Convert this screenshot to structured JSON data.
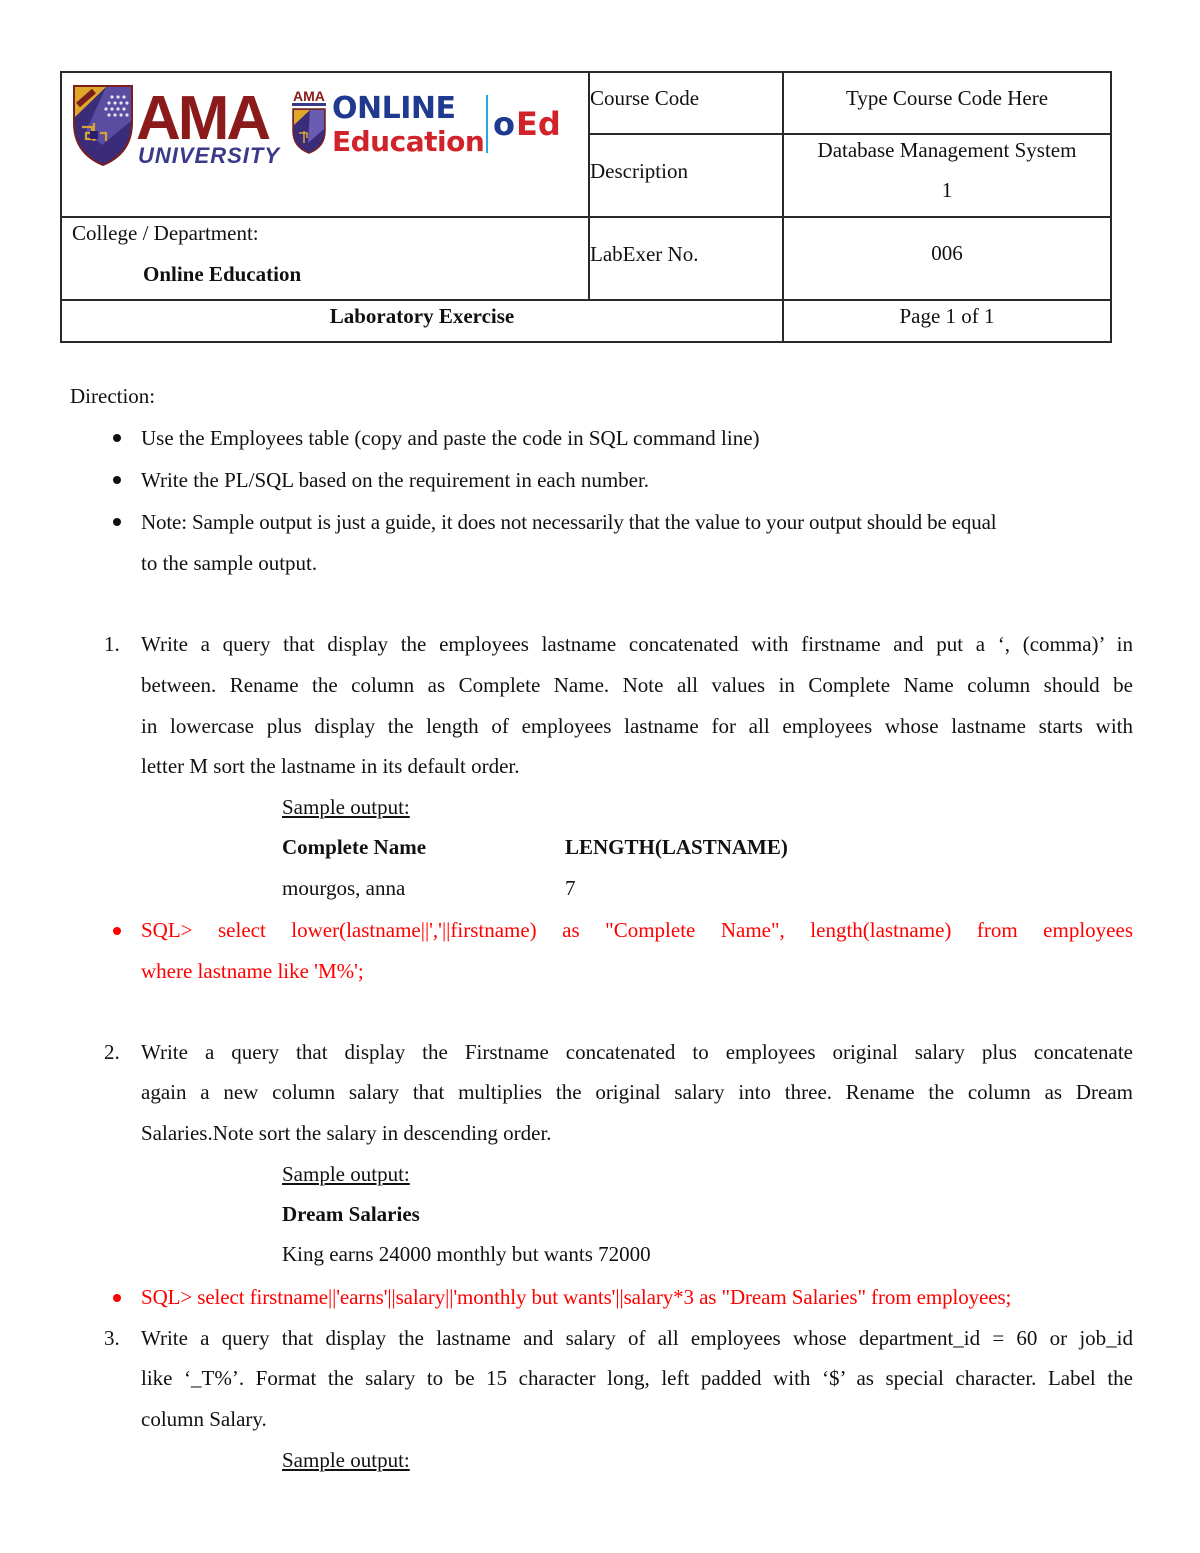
{
  "header": {
    "logos": {
      "ama_university": {
        "main": "AMA",
        "sub": "UNIVERSITY"
      },
      "online_education": {
        "line1": "ONLINE",
        "line2": "Education",
        "abbr": "OEd",
        "badge": "AMA"
      }
    },
    "course_code_label": "Course Code",
    "course_code_value": "Type Course Code Here",
    "description_label": "Description",
    "description_value_line1": "Database Management System",
    "description_value_line2": "1",
    "college_label": "College / Department:",
    "college_value": "Online Education",
    "labexer_label": "LabExer No.",
    "labexer_value": "006",
    "title": "Laboratory Exercise",
    "page": "Page 1 of 1"
  },
  "colors": {
    "answer_red": "#ff0000",
    "ama_maroon": "#8b1a1a",
    "oed_blue": "#1f3a8f",
    "oed_red": "#d0232a",
    "divider_cyan": "#29a8e0"
  },
  "direction": {
    "label": "Direction:",
    "bullets": [
      "Use the Employees table (copy and paste the code in SQL command line)",
      "Write the PL/SQL based on the requirement in each number.",
      "Note: Sample output is just a guide, it does not necessarily that the value to your output should be equal",
      "to the sample output."
    ]
  },
  "questions": [
    {
      "number": "1.",
      "lines": [
        "Write a query that display the employees lastname concatenated with firstname and put a ‘, (comma)’ in",
        "between. Rename the column as Complete Name. Note all values in Complete Name column should be",
        "in lowercase plus display the length of employees lastname for all employees whose lastname starts with",
        "letter M sort the lastname in its default order."
      ],
      "sample_label": "Sample output:",
      "sample_headers": [
        "Complete Name",
        "LENGTH(LASTNAME)"
      ],
      "sample_rows": [
        [
          "mourgos, anna",
          "7"
        ]
      ],
      "answer_lines": [
        "SQL> select lower(lastname||','||firstname) as \"Complete Name\", length(lastname) from employees",
        "where lastname like 'M%';"
      ]
    },
    {
      "number": "2.",
      "lines": [
        "Write a query that display the Firstname concatenated to employees original salary plus concatenate",
        "again a new column salary that multiplies the original salary into three. Rename the column as Dream",
        "Salaries.Note sort the salary in descending order."
      ],
      "sample_label": "Sample output:",
      "sample_headers": [
        "Dream Salaries"
      ],
      "sample_rows": [
        [
          "King earns 24000 monthly but wants 72000"
        ]
      ],
      "answer_lines": [
        "SQL> select firstname||'earns'||salary||'monthly but wants'||salary*3 as \"Dream Salaries\" from employees;"
      ]
    },
    {
      "number": "3.",
      "lines": [
        "Write a query that display the lastname and salary of all employees whose department_id = 60 or job_id",
        "like ‘_T%’. Format the salary to be 15 character long, left padded with ‘$’ as special character. Label the",
        "column Salary."
      ],
      "sample_label": "Sample output:"
    }
  ]
}
